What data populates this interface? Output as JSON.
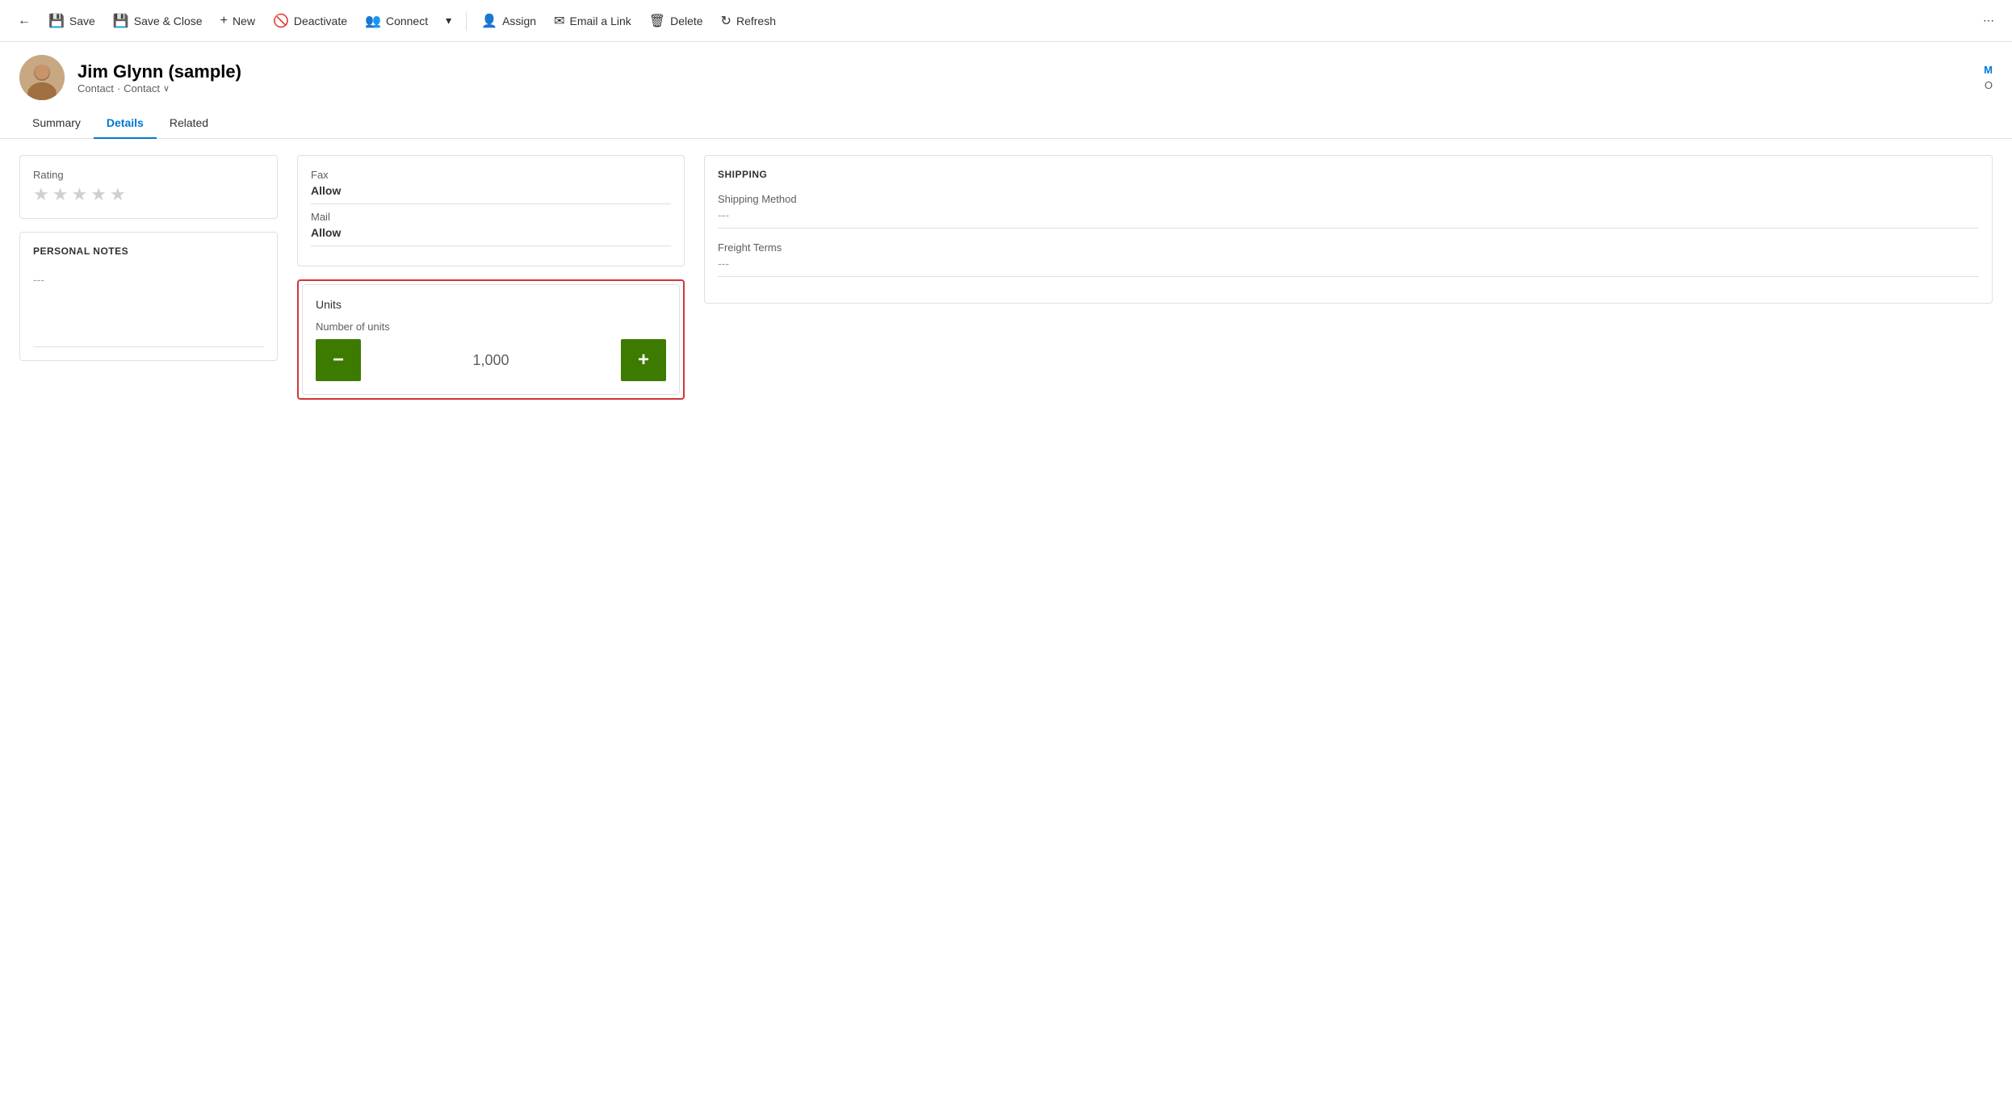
{
  "toolbar": {
    "back_icon": "←",
    "save_label": "Save",
    "save_close_label": "Save & Close",
    "new_label": "New",
    "deactivate_label": "Deactivate",
    "connect_label": "Connect",
    "dropdown_icon": "▾",
    "assign_label": "Assign",
    "email_link_label": "Email a Link",
    "delete_label": "Delete",
    "refresh_label": "Refresh",
    "more_icon": "⋯"
  },
  "record": {
    "name": "Jim Glynn (sample)",
    "type1": "Contact",
    "type2": "Contact",
    "header_right_line1": "M",
    "header_right_line2": "O"
  },
  "tabs": [
    {
      "id": "summary",
      "label": "Summary"
    },
    {
      "id": "details",
      "label": "Details",
      "active": true
    },
    {
      "id": "related",
      "label": "Related"
    }
  ],
  "left_column": {
    "rating_section": {
      "field_label": "Rating",
      "stars": [
        false,
        false,
        false,
        false,
        false
      ]
    },
    "personal_notes": {
      "title": "PERSONAL NOTES",
      "content": "---"
    }
  },
  "middle_column": {
    "contact_card": {
      "fields": [
        {
          "label": "Fax",
          "value": "Allow",
          "bold": true
        },
        {
          "label": "Mail",
          "value": "Allow",
          "bold": true
        }
      ]
    },
    "units_card": {
      "title": "Units",
      "field_label": "Number of units",
      "value": "1,000",
      "minus_label": "−",
      "plus_label": "+"
    }
  },
  "right_column": {
    "shipping": {
      "title": "SHIPPING",
      "fields": [
        {
          "label": "Shipping Method",
          "value": "---",
          "empty": true
        },
        {
          "label": "Freight Terms",
          "value": "---",
          "empty": true
        }
      ]
    }
  }
}
